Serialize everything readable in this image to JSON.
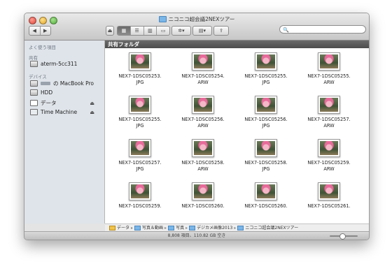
{
  "window": {
    "title": "ニコニコ超会議2NEXツアー"
  },
  "toolbar": {
    "back": "◀",
    "forward": "▶",
    "view_modes": [
      "▦",
      "☰",
      "▥",
      "▭"
    ],
    "action": "✲▾",
    "arrange": "▤▾",
    "share": "⇪",
    "search_placeholder": "🔍",
    "eject": "⏏"
  },
  "sidebar": {
    "favorites_header": "よく使う項目",
    "shared_header": "共有",
    "shared_items": [
      {
        "label": "aterm-5cc311",
        "icon": "network-computer-icon"
      }
    ],
    "devices_header": "デバイス",
    "devices": [
      {
        "label": "の MacBook Pro",
        "icon": "laptop-icon",
        "eject": false
      },
      {
        "label": "HDD",
        "icon": "hard-drive-icon",
        "eject": false
      },
      {
        "label": "データ",
        "icon": "external-drive-icon",
        "eject": true
      },
      {
        "label": "Time Machine",
        "icon": "time-machine-icon",
        "eject": true
      }
    ]
  },
  "content": {
    "header": "共有フォルダ",
    "files": [
      {
        "name": "NEX7-1DSC05253.\nJPG"
      },
      {
        "name": "NEX7-1DSC05254.\nARW"
      },
      {
        "name": "NEX7-1DSC05255.\nJPG"
      },
      {
        "name": "NEX7-1DSC05255.\nARW"
      },
      {
        "name": "NEX7-1DSC05255.\nJPG"
      },
      {
        "name": "NEX7-1DSC05256.\nARW"
      },
      {
        "name": "NEX7-1DSC05256.\nJPG"
      },
      {
        "name": "NEX7-1DSC05257.\nARW"
      },
      {
        "name": "NEX7-1DSC05257.\nJPG"
      },
      {
        "name": "NEX7-1DSC05258.\nARW"
      },
      {
        "name": "NEX7-1DSC05258.\nJPG"
      },
      {
        "name": "NEX7-1DSC05259.\nARW"
      },
      {
        "name": "NEX7-1DSC05259."
      },
      {
        "name": "NEX7-1DSC05260."
      },
      {
        "name": "NEX7-1DSC05260."
      },
      {
        "name": "NEX7-1DSC05261."
      }
    ]
  },
  "pathbar": {
    "crumbs": [
      {
        "label": "データ",
        "icon": "drive"
      },
      {
        "label": "写真＆動画",
        "icon": "folder"
      },
      {
        "label": "写真",
        "icon": "folder"
      },
      {
        "label": "デジカメ画像2013",
        "icon": "folder"
      },
      {
        "label": "ニコニコ超会議2NEXツアー",
        "icon": "folder"
      }
    ],
    "separator": "▸"
  },
  "status": {
    "text": "8,808 項目、110.82 GB 空き"
  }
}
